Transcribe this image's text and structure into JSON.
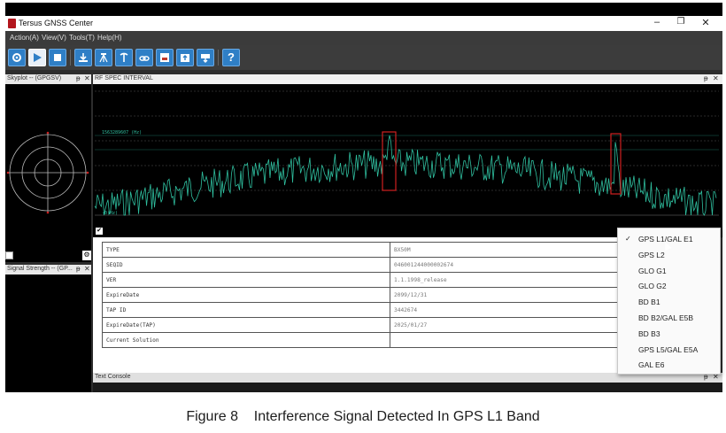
{
  "window": {
    "title": "Tersus GNSS Center",
    "minimize": "–",
    "restore": "❐",
    "close": "✕"
  },
  "menu": [
    "Action(A)",
    "View(V)",
    "Tools(T)",
    "Help(H)"
  ],
  "toolbar": {
    "buttons": [
      "settings-icon",
      "play-icon",
      "stop-icon",
      "download-icon",
      "survey-tripod-icon",
      "pole-icon",
      "link-icon",
      "record-icon",
      "upload-icon",
      "transfer-icon",
      "help-icon"
    ],
    "help_label": "?"
  },
  "skyplot": {
    "title": "Skyplot -- (GPGSV)",
    "pin": "ᵽ",
    "close": "✕"
  },
  "signal_strength": {
    "title": "Signal Strength -- (GP...",
    "pin": "ᵽ",
    "close": "✕"
  },
  "rf_spec": {
    "title": "RF SPEC INTERVAL",
    "pin": "ᵽ",
    "close": "✕",
    "marker_label": "1563289607 (Hz)",
    "bottom_label": "-0(Hz)",
    "color": "#2fbf9f",
    "highlight_color": "#d02020"
  },
  "info_table": [
    {
      "label": "TYPE",
      "value": "BX50M"
    },
    {
      "label": "SEQID",
      "value": "046001244000002674"
    },
    {
      "label": "VER",
      "value": "1.1.1998_release"
    },
    {
      "label": "ExpireDate",
      "value": "2099/12/31"
    },
    {
      "label": "TAP ID",
      "value": "3442674"
    },
    {
      "label": "ExpireDate(TAP)",
      "value": "2025/01/27"
    },
    {
      "label": "Current Solution",
      "value": ""
    }
  ],
  "band_dropdown": {
    "selected": "GPS L1/GAL E1",
    "options": [
      "GPS L1/GAL E1",
      "GPS L2",
      "GLO G1",
      "GLO G2",
      "BD B1",
      "BD B2/GAL E5B",
      "BD B3",
      "GPS L5/GAL E5A",
      "GAL E6"
    ],
    "check": "✓"
  },
  "text_console": {
    "title": "Text Console",
    "pin": "ᵽ",
    "close": "✕"
  },
  "caption": "Figure 8    Interference Signal Detected In GPS L1 Band"
}
